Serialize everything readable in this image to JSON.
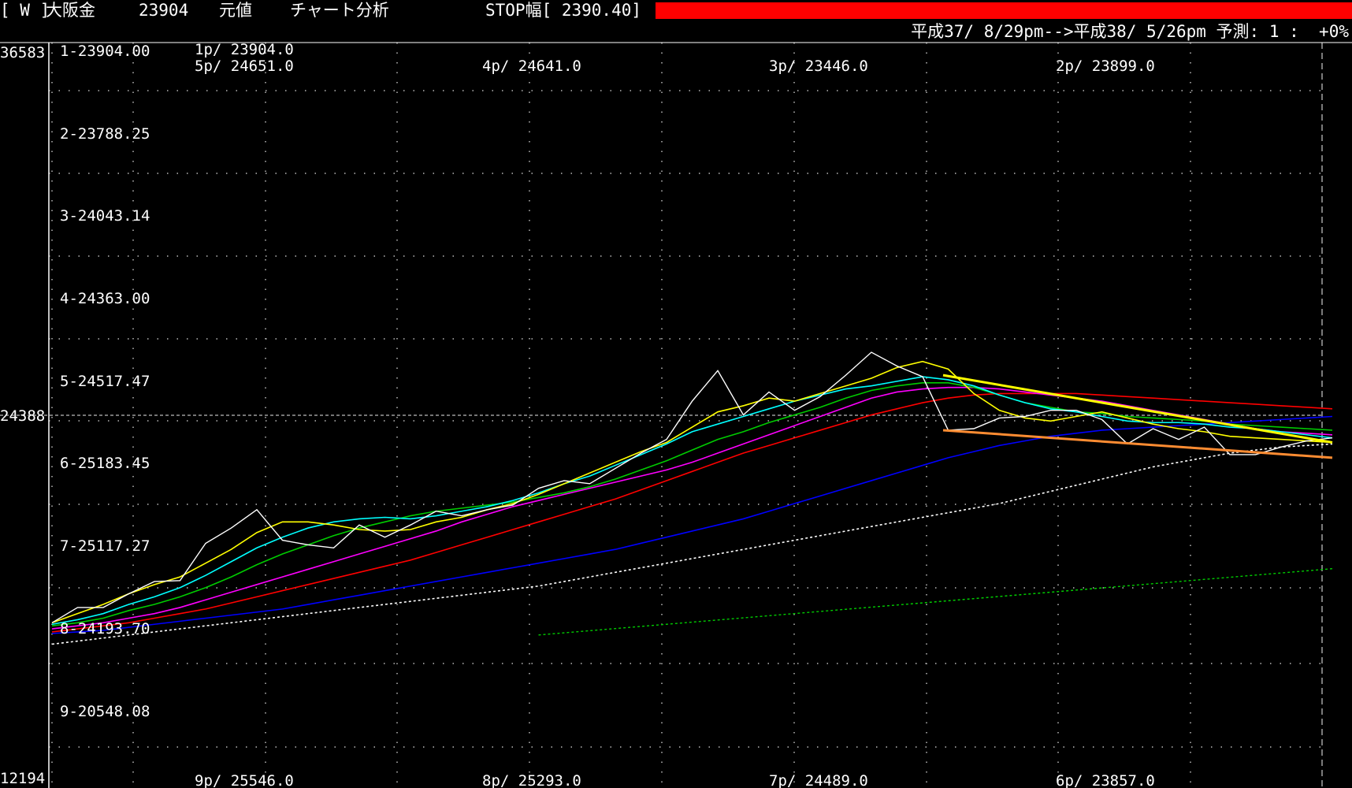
{
  "header": {
    "window_tag": "[ W ]",
    "instrument": "大阪金",
    "price": "23904",
    "mode": "元値",
    "tool": "チャート分析",
    "stop_label": "STOP幅[ 2390.40]"
  },
  "subheader": {
    "period": "平成37/ 8/29pm-->平成38/ 5/26pm 予測: 1 :  +0%"
  },
  "colors": {
    "price": "#ffffff",
    "ma1": "#ffff00",
    "ma2": "#00ffff",
    "ma3": "#00cc00",
    "ma4": "#ff00ff",
    "ma5": "#ff0000",
    "ma6": "#0000ff",
    "ma7": "#ffffff",
    "ma8": "#00cc00",
    "trend_upper": "#ffff00",
    "trend_lower": "#ff8c32",
    "stopbar": "#ff0000"
  },
  "chart_data": {
    "type": "line",
    "ylim": [
      12194,
      36583
    ],
    "y_max_label": "36583",
    "y_min_label": "12194",
    "mid_value": 24388,
    "mid_label": "24388",
    "band_labels": [
      "1-23904.00",
      "2-23788.25",
      "3-24043.14",
      "4-24363.00",
      "5-24517.47",
      "6-25183.45",
      "7-25117.27",
      "8-24193.70",
      "9-20548.08"
    ],
    "point_labels_top": [
      "1p/ 23904.0",
      "5p/ 24651.0",
      "4p/ 24641.0",
      "3p/ 23446.0",
      "2p/ 23899.0"
    ],
    "point_labels_bottom": [
      "9p/ 25546.0",
      "8p/ 25293.0",
      "7p/ 24489.0",
      "6p/ 23857.0"
    ],
    "x": [
      0,
      1,
      2,
      3,
      4,
      5,
      6,
      7,
      8,
      9,
      10,
      11,
      12,
      13,
      14,
      15,
      16,
      17,
      18,
      19,
      20,
      21,
      22,
      23,
      24,
      25,
      26,
      27,
      28,
      29,
      30,
      31,
      32,
      33,
      34,
      35,
      36,
      37,
      38,
      39,
      40,
      41,
      42,
      43,
      44,
      45,
      46,
      47,
      48,
      49,
      50
    ],
    "series": [
      {
        "key": "price",
        "values": [
          17600,
          18100,
          18100,
          18550,
          18950,
          18980,
          20200,
          20700,
          21300,
          20300,
          20150,
          20050,
          20800,
          20400,
          20800,
          21250,
          21100,
          21300,
          21450,
          22000,
          22250,
          22150,
          22650,
          23150,
          23600,
          24850,
          25850,
          24400,
          25150,
          24550,
          25000,
          25700,
          26450,
          26000,
          25650,
          23900,
          23950,
          24300,
          24350,
          24550,
          24550,
          24250,
          23450,
          23950,
          23600,
          24000,
          23100,
          23100,
          23350,
          23550,
          23650
        ]
      },
      {
        "key": "ma1",
        "values": [
          17600,
          17900,
          18200,
          18550,
          18850,
          19100,
          19550,
          20000,
          20550,
          20900,
          20900,
          20800,
          20650,
          20600,
          20650,
          20900,
          21050,
          21300,
          21500,
          21800,
          22150,
          22500,
          22850,
          23200,
          23500,
          24000,
          24500,
          24700,
          24950,
          24850,
          25100,
          25350,
          25600,
          25950,
          26150,
          25900,
          25100,
          24550,
          24300,
          24200,
          24350,
          24500,
          24300,
          24100,
          23950,
          23850,
          23700,
          23650,
          23600,
          23550,
          23500
        ]
      },
      {
        "key": "ma2",
        "values": [
          17550,
          17700,
          17900,
          18200,
          18450,
          18750,
          19150,
          19600,
          20050,
          20400,
          20700,
          20900,
          21000,
          21050,
          21000,
          21100,
          21250,
          21400,
          21600,
          21850,
          22150,
          22400,
          22750,
          23100,
          23450,
          23850,
          24100,
          24350,
          24600,
          24850,
          25050,
          25250,
          25350,
          25500,
          25650,
          25550,
          25350,
          25050,
          24800,
          24600,
          24500,
          24350,
          24200,
          24150,
          24150,
          24100,
          24000,
          23950,
          23850,
          23750,
          23650
        ]
      },
      {
        "key": "ma3",
        "values": [
          17500,
          17600,
          17750,
          18000,
          18200,
          18450,
          18750,
          19100,
          19500,
          19850,
          20150,
          20450,
          20700,
          20900,
          21100,
          21250,
          21350,
          21450,
          21550,
          21700,
          21850,
          22050,
          22300,
          22600,
          22900,
          23250,
          23600,
          23850,
          24150,
          24400,
          24650,
          24950,
          25200,
          25350,
          25450,
          25450,
          25300,
          25050,
          24800,
          24650,
          24500,
          24450,
          24350,
          24300,
          24250,
          24200,
          24100,
          24050,
          24000,
          23950,
          23900
        ]
      },
      {
        "key": "ma4",
        "values": [
          17400,
          17500,
          17600,
          17750,
          17900,
          18100,
          18350,
          18600,
          18850,
          19100,
          19350,
          19600,
          19850,
          20100,
          20350,
          20600,
          20900,
          21150,
          21400,
          21600,
          21800,
          22000,
          22200,
          22400,
          22600,
          22850,
          23150,
          23450,
          23750,
          24050,
          24350,
          24650,
          24950,
          25150,
          25250,
          25300,
          25300,
          25250,
          25150,
          25050,
          24950,
          24850,
          24700,
          24550,
          24400,
          24250,
          24100,
          23950,
          23850,
          23800,
          23750
        ]
      },
      {
        "key": "ma5",
        "values": [
          17300,
          17400,
          17500,
          17600,
          17750,
          17900,
          18050,
          18250,
          18450,
          18650,
          18850,
          19050,
          19250,
          19450,
          19650,
          19900,
          20150,
          20400,
          20650,
          20900,
          21150,
          21400,
          21650,
          21950,
          22250,
          22550,
          22850,
          23150,
          23400,
          23650,
          23900,
          24150,
          24400,
          24600,
          24800,
          24950,
          25050,
          25100,
          25100,
          25100,
          25100,
          25050,
          25000,
          24950,
          24900,
          24850,
          24800,
          24750,
          24700,
          24650,
          24600
        ]
      },
      {
        "key": "ma6",
        "values": [
          17250,
          17300,
          17350,
          17450,
          17550,
          17650,
          17750,
          17850,
          17950,
          18050,
          18200,
          18350,
          18500,
          18650,
          18800,
          18950,
          19100,
          19250,
          19400,
          19550,
          19700,
          19850,
          20000,
          20200,
          20400,
          20600,
          20800,
          21000,
          21250,
          21500,
          21750,
          22000,
          22250,
          22500,
          22750,
          23000,
          23200,
          23400,
          23550,
          23700,
          23800,
          23900,
          23950,
          24000,
          24050,
          24100,
          24150,
          24200,
          24250,
          24300,
          24350
        ]
      },
      {
        "key": "ma7",
        "values": [
          16900,
          17000,
          17100,
          17200,
          17300,
          17400,
          17500,
          17600,
          17700,
          17800,
          17900,
          18000,
          18100,
          18200,
          18300,
          18400,
          18500,
          18600,
          18700,
          18800,
          18950,
          19100,
          19250,
          19400,
          19550,
          19700,
          19850,
          20000,
          20150,
          20300,
          20450,
          20600,
          20750,
          20900,
          21050,
          21200,
          21350,
          21500,
          21700,
          21900,
          22100,
          22300,
          22500,
          22700,
          22850,
          23000,
          23150,
          23250,
          23350,
          23400,
          23450
        ]
      }
    ],
    "series_lt": {
      "key": "ma8",
      "start_index": 19,
      "values": [
        17200,
        17270,
        17340,
        17410,
        17480,
        17550,
        17620,
        17690,
        17760,
        17830,
        17900,
        17970,
        18040,
        18110,
        18180,
        18250,
        18320,
        18390,
        18460,
        18530,
        18600,
        18670,
        18740,
        18810,
        18880,
        18950,
        19020,
        19090,
        19160,
        19230,
        19300,
        19370
      ]
    },
    "trendlines": [
      {
        "key": "trend_upper",
        "from": [
          34.8,
          25700
        ],
        "to": [
          50.0,
          23500
        ]
      },
      {
        "key": "trend_lower",
        "from": [
          34.8,
          23900
        ],
        "to": [
          50.0,
          23000
        ]
      }
    ]
  }
}
